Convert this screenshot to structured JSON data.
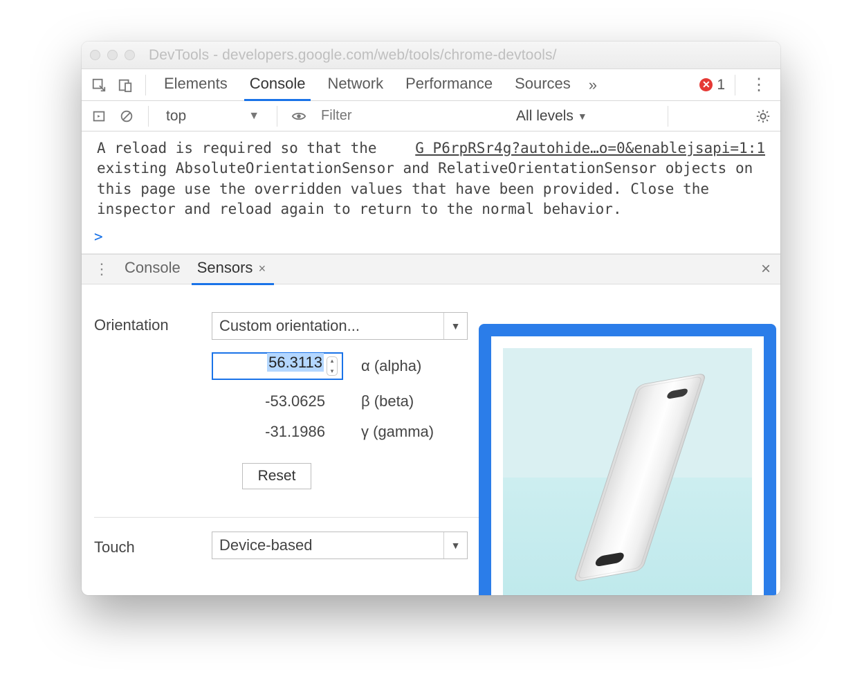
{
  "window": {
    "title": "DevTools - developers.google.com/web/tools/chrome-devtools/"
  },
  "tabs": {
    "items": [
      "Elements",
      "Console",
      "Network",
      "Performance",
      "Sources"
    ],
    "active": 1,
    "more_glyph": "»",
    "error_count": "1"
  },
  "console_toolbar": {
    "context": "top",
    "filter_placeholder": "Filter",
    "levels_label": "All levels"
  },
  "console_msg": {
    "line1_pre": "A reload is required so that the ",
    "line1_link": "G P6rpRSr4g?autohide…o=0&enablejsapi=1:1",
    "rest": "existing AbsoluteOrientationSensor and RelativeOrientationSensor objects on this page use the overridden values that have been provided. Close the inspector and reload again to return to the normal behavior."
  },
  "console_prompt": ">",
  "drawer": {
    "tabs": [
      "Console",
      "Sensors"
    ],
    "active": 1,
    "close_glyph": "×",
    "panel_close": "×"
  },
  "sensors": {
    "orientation_label": "Orientation",
    "orientation_select": "Custom orientation...",
    "alpha_value": "56.3113",
    "alpha_label": "α (alpha)",
    "beta_value": "-53.0625",
    "beta_label": "β (beta)",
    "gamma_value": "-31.1986",
    "gamma_label": "γ (gamma)",
    "reset_label": "Reset",
    "touch_label": "Touch",
    "touch_select": "Device-based"
  }
}
